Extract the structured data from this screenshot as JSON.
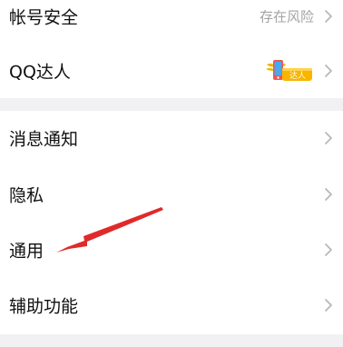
{
  "group1": {
    "items": [
      {
        "label": "帐号安全",
        "value": "存在风险"
      },
      {
        "label": "QQ达人",
        "badge_text": "达人"
      }
    ]
  },
  "group2": {
    "items": [
      {
        "label": "消息通知"
      },
      {
        "label": "隐私"
      },
      {
        "label": "通用"
      },
      {
        "label": "辅助功能"
      }
    ]
  },
  "colors": {
    "background": "#f1f1f4",
    "row_background": "#ffffff",
    "secondary_text": "#a4a4a8",
    "annotation_arrow": "#e02a2a"
  }
}
